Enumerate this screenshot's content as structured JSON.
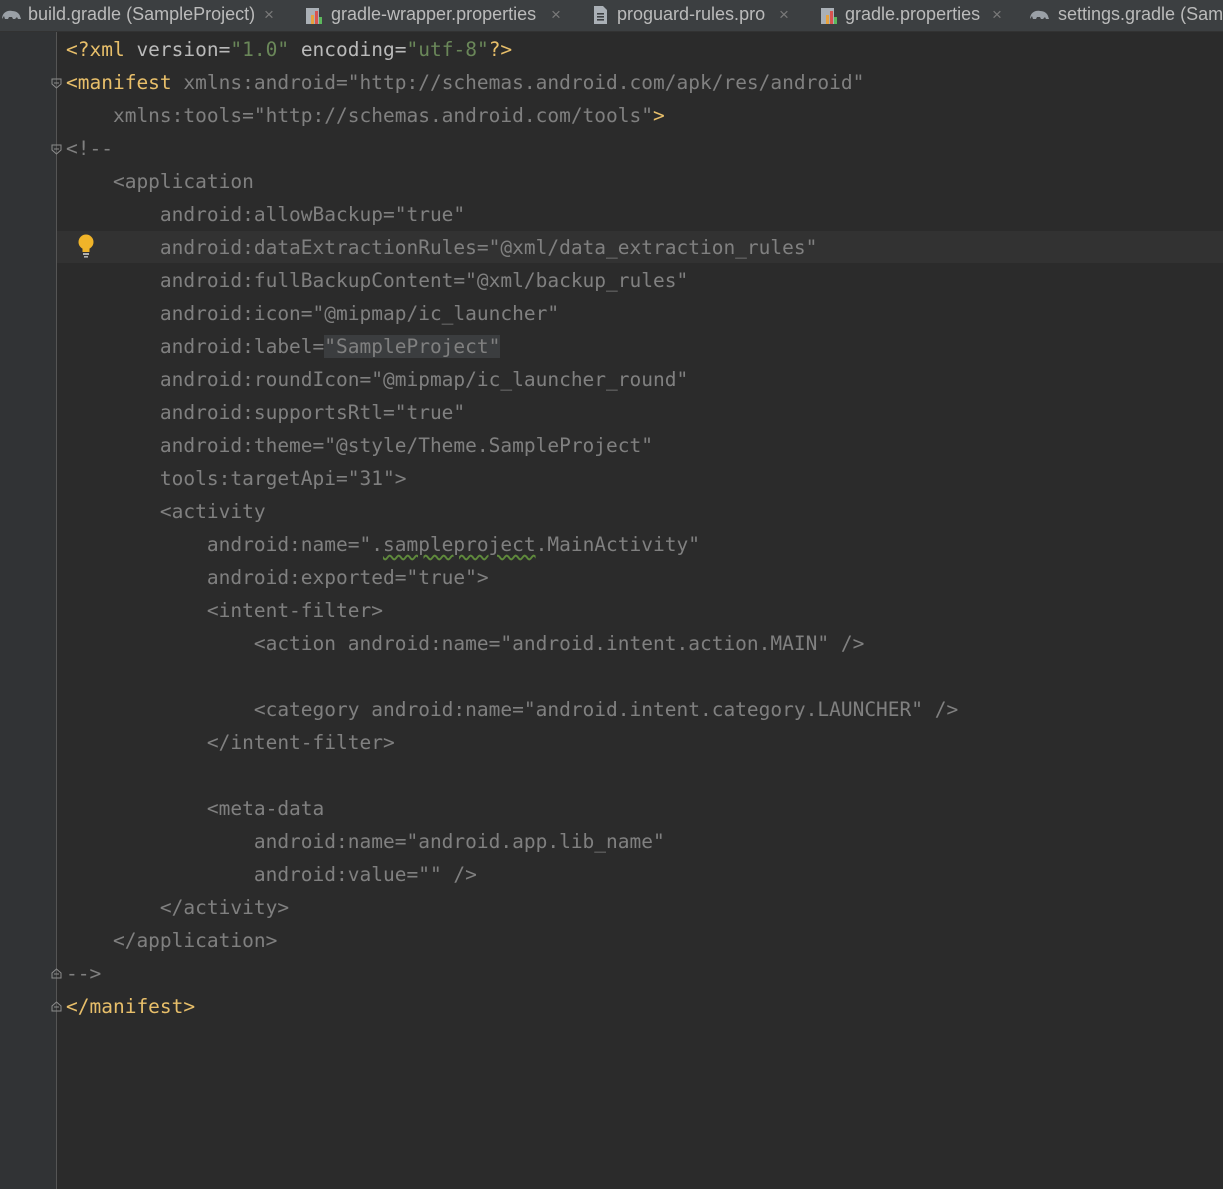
{
  "tabs": [
    {
      "label": "build.gradle (SampleProject)",
      "icon": "gradle-elephant-icon",
      "closable": true
    },
    {
      "label": "gradle-wrapper.properties",
      "icon": "properties-file-icon",
      "closable": true
    },
    {
      "label": "proguard-rules.pro",
      "icon": "text-file-icon",
      "closable": true
    },
    {
      "label": "gradle.properties",
      "icon": "properties-file-icon",
      "closable": true
    },
    {
      "label": "settings.gradle (Sam",
      "icon": "gradle-elephant-icon",
      "closable": false
    }
  ],
  "close_glyph": "×",
  "code": {
    "l1": {
      "a": "<?xml",
      "b": " version",
      "c": "=",
      "d": "\"1.0\"",
      "e": " encoding",
      "f": "=",
      "g": "\"utf-8\"",
      "h": "?>"
    },
    "l2": {
      "a": "<manifest",
      "b": " xmlns:android=\"http://schemas.android.com/apk/res/android\""
    },
    "l3": {
      "a": "    xmlns:tools=\"http://schemas.android.com/tools\"",
      "b": ">"
    },
    "l4": "<!--",
    "l5": "    <application",
    "l6": "        android:allowBackup=\"true\"",
    "l7": "        android:dataExtractionRules=\"@xml/data_extraction_rules\"",
    "l8": "        android:fullBackupContent=\"@xml/backup_rules\"",
    "l9": "        android:icon=\"@mipmap/ic_launcher\"",
    "l10": {
      "a": "        android:label=",
      "b": "\"SampleProject\""
    },
    "l11": "        android:roundIcon=\"@mipmap/ic_launcher_round\"",
    "l12": "        android:supportsRtl=\"true\"",
    "l13": "        android:theme=\"@style/Theme.SampleProject\"",
    "l14": "        tools:targetApi=\"31\">",
    "l15": "        <activity",
    "l16": {
      "a": "            android:name=\".",
      "b": "sampleproject",
      "c": ".MainActivity\""
    },
    "l17": "            android:exported=\"true\">",
    "l18": "            <intent-filter>",
    "l19": "                <action android:name=\"android.intent.action.MAIN\" />",
    "l20": "",
    "l21": "                <category android:name=\"android.intent.category.LAUNCHER\" />",
    "l22": "            </intent-filter>",
    "l23": "",
    "l24": "            <meta-data",
    "l25": "                android:name=\"android.app.lib_name\"",
    "l26": "                android:value=\"\" />",
    "l27": "        </activity>",
    "l28": "    </application>",
    "l29": "-->",
    "l30": "</manifest>"
  },
  "colors": {
    "background": "#2b2b2b",
    "tag": "#e8bf6a",
    "attribute": "#bababa",
    "string": "#6a8759",
    "comment": "#808080",
    "intention_bulb": "#f0b429"
  }
}
